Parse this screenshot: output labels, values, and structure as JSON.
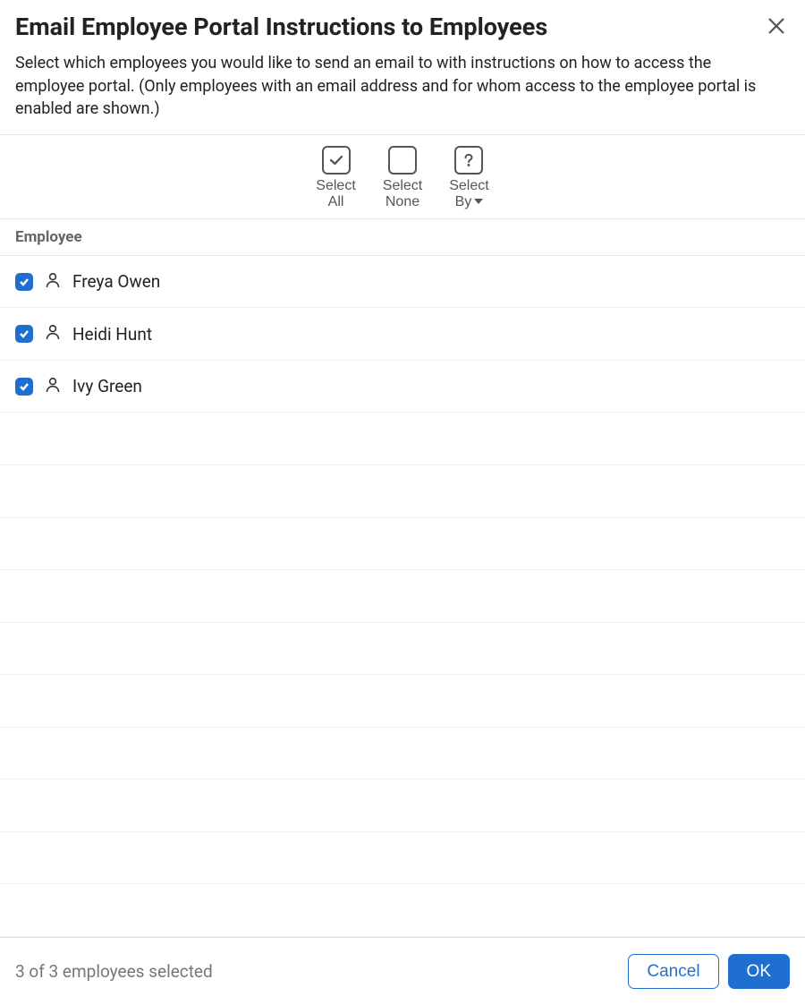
{
  "header": {
    "title": "Email Employee Portal Instructions to Employees",
    "instructions": "Select which employees you would like to send an email to with instructions on how to access the employee portal. (Only employees with an email address and for whom access to the employee portal is enabled are shown.)"
  },
  "toolbar": {
    "select_all": {
      "line1": "Select",
      "line2": "All"
    },
    "select_none": {
      "line1": "Select",
      "line2": "None"
    },
    "select_by": {
      "line1": "Select",
      "line2": "By"
    }
  },
  "table": {
    "header": "Employee",
    "rows": [
      {
        "name": "Freya Owen",
        "checked": true
      },
      {
        "name": "Heidi Hunt",
        "checked": true
      },
      {
        "name": "Ivy Green",
        "checked": true
      }
    ]
  },
  "footer": {
    "status": "3 of 3 employees selected",
    "cancel": "Cancel",
    "ok": "OK"
  }
}
